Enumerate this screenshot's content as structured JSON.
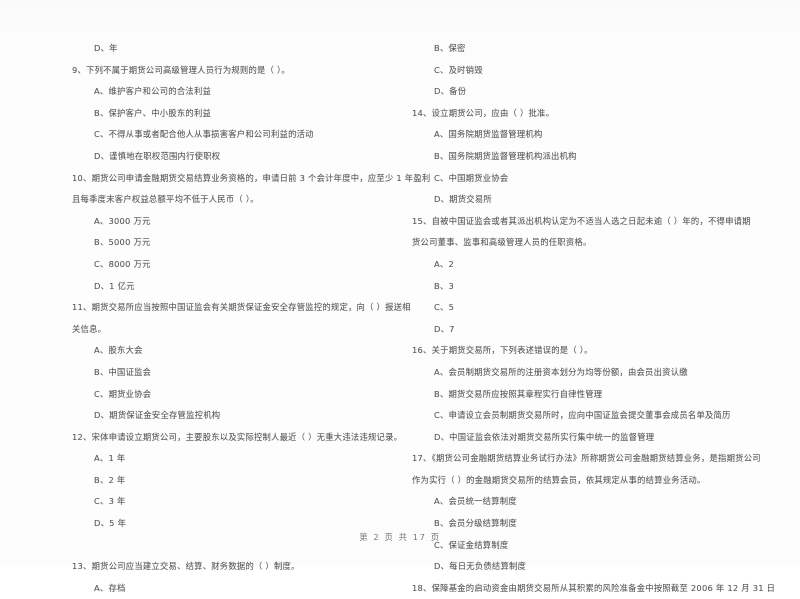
{
  "document": {
    "page_footer": "第 2 页 共 17 页",
    "page_number": "2",
    "total_pages": "17"
  },
  "left_column": {
    "lines": [
      {
        "type": "opt",
        "text": "D、年"
      },
      {
        "type": "q",
        "text": "9、下列不属于期货公司高级管理人员行为规则的是（    ）。"
      },
      {
        "type": "opt",
        "text": "A、维护客户和公司的合法利益"
      },
      {
        "type": "opt",
        "text": "B、保护客户、中小股东的利益"
      },
      {
        "type": "opt",
        "text": "C、不得从事或者配合他人从事损害客户和公司利益的活动"
      },
      {
        "type": "opt",
        "text": "D、谨慎地在职权范围内行使职权"
      },
      {
        "type": "q",
        "text": "10、期货公司申请金融期货交易结算业务资格的，申请日前 3 个会计年度中，应至少 1 年盈利"
      },
      {
        "type": "cont",
        "text": "且每季度末客户权益总额平均不低于人民币（    ）。"
      },
      {
        "type": "opt",
        "text": "A、3000 万元"
      },
      {
        "type": "opt",
        "text": "B、5000 万元"
      },
      {
        "type": "opt",
        "text": "C、8000 万元"
      },
      {
        "type": "opt",
        "text": "D、1 亿元"
      },
      {
        "type": "q",
        "text": "11、期货交易所应当按照中国证监会有关期货保证金安全存管监控的规定，向（    ）报送相"
      },
      {
        "type": "cont",
        "text": "关信息。"
      },
      {
        "type": "opt",
        "text": "A、股东大会"
      },
      {
        "type": "opt",
        "text": "B、中国证监会"
      },
      {
        "type": "opt",
        "text": "C、期货业协会"
      },
      {
        "type": "opt",
        "text": "D、期货保证金安全存管监控机构"
      },
      {
        "type": "q",
        "text": "12、宋体申请设立期货公司，主要股东以及实际控制人最近（    ）无重大违法违规记录。"
      },
      {
        "type": "opt",
        "text": "A、1 年"
      },
      {
        "type": "opt",
        "text": "B、2 年"
      },
      {
        "type": "opt",
        "text": "C、3 年"
      },
      {
        "type": "opt",
        "text": "D、5 年"
      },
      {
        "type": "spacer"
      },
      {
        "type": "q",
        "text": "13、期货公司应当建立交易、结算、财务数据的（    ）制度。"
      },
      {
        "type": "opt",
        "text": "A、存档"
      }
    ]
  },
  "right_column": {
    "lines": [
      {
        "type": "opt",
        "text": "B、保密"
      },
      {
        "type": "opt",
        "text": "C、及时销毁"
      },
      {
        "type": "opt",
        "text": "D、备份"
      },
      {
        "type": "q",
        "text": "14、设立期货公司，应由（    ）批准。"
      },
      {
        "type": "opt",
        "text": "A、国务院期货监督管理机构"
      },
      {
        "type": "opt",
        "text": "B、国务院期货监督管理机构派出机构"
      },
      {
        "type": "opt",
        "text": "C、中国期货业协会"
      },
      {
        "type": "opt",
        "text": "D、期货交易所"
      },
      {
        "type": "q",
        "text": "15、自被中国证监会或者其派出机构认定为不适当人选之日起未逾（    ）年的，不得申请期"
      },
      {
        "type": "cont",
        "text": "货公司董事、监事和高级管理人员的任职资格。"
      },
      {
        "type": "opt",
        "text": "A、2"
      },
      {
        "type": "opt",
        "text": "B、3"
      },
      {
        "type": "opt",
        "text": "C、5"
      },
      {
        "type": "opt",
        "text": "D、7"
      },
      {
        "type": "q",
        "text": "16、关于期货交易所，下列表述错误的是（    ）。"
      },
      {
        "type": "opt",
        "text": "A、会员制期货交易所的注册资本划分为均等份额，由会员出资认缴"
      },
      {
        "type": "opt",
        "text": "B、期货交易所应按照其章程实行自律性管理"
      },
      {
        "type": "opt",
        "text": "C、申请设立会员制期货交易所时，应向中国证监会提交董事会成员名单及简历"
      },
      {
        "type": "opt",
        "text": "D、中国证监会依法对期货交易所实行集中统一的监督管理"
      },
      {
        "type": "q",
        "text": "17、《期货公司金融期货结算业务试行办法》所称期货公司金融期货结算业务，是指期货公司"
      },
      {
        "type": "cont",
        "text": "作为实行（    ）的金融期货交易所的结算会员，依其规定从事的结算业务活动。"
      },
      {
        "type": "opt",
        "text": "A、会员统一结算制度"
      },
      {
        "type": "opt",
        "text": "B、会员分级结算制度"
      },
      {
        "type": "opt",
        "text": "C、保证金结算制度"
      },
      {
        "type": "opt",
        "text": "D、每日无负债结算制度"
      },
      {
        "type": "q",
        "text": "18、保障基金的启动资金由期货交易所从其积累的风险准备金中按照截至 2006 年 12 月 31 日"
      }
    ]
  }
}
